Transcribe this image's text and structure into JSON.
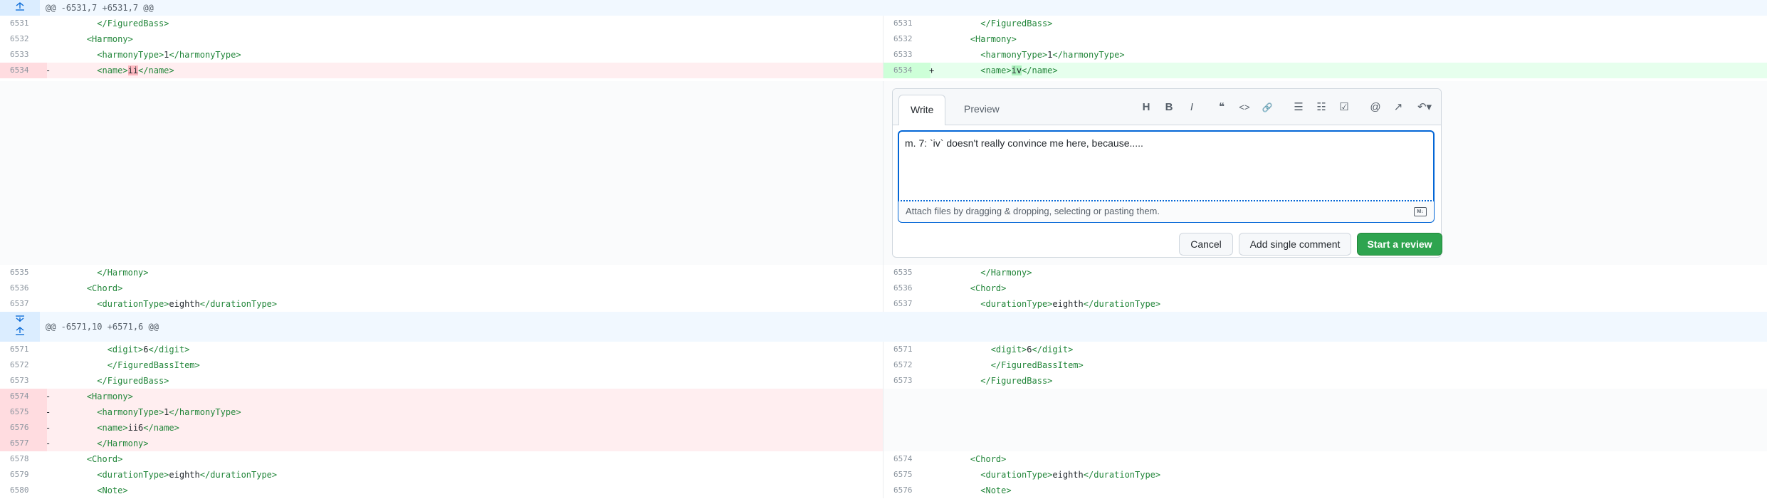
{
  "hunks": [
    {
      "header": "@@ -6531,7 +6531,7 @@"
    },
    {
      "header": "@@ -6571,10 +6571,6 @@"
    }
  ],
  "rows": {
    "r1": {
      "ln": "6531",
      "rn": "6531",
      "lindent": "        ",
      "rindent": "        ",
      "tag1": "</FiguredBass>"
    },
    "r2": {
      "ln": "6532",
      "rn": "6532",
      "lindent": "      ",
      "rindent": "      ",
      "tag1": "<Harmony>"
    },
    "r3": {
      "ln": "6533",
      "rn": "6533",
      "lindent": "        ",
      "rindent": "        ",
      "tag1": "<harmonyType>",
      "val": "1",
      "tag2": "</harmonyType>"
    },
    "r4": {
      "ln": "6534",
      "rn": "6534",
      "lsign": "-",
      "rsign": "+",
      "lindent": "        ",
      "rindent": "        ",
      "tag1": "<name>",
      "lval": "ii",
      "rval": "iv",
      "tag2": "</name>"
    },
    "r5": {
      "ln": "6535",
      "rn": "6535",
      "lindent": "        ",
      "rindent": "        ",
      "tag1": "</Harmony>"
    },
    "r6": {
      "ln": "6536",
      "rn": "6536",
      "lindent": "      ",
      "rindent": "      ",
      "tag1": "<Chord>"
    },
    "r7": {
      "ln": "6537",
      "rn": "6537",
      "lindent": "        ",
      "rindent": "        ",
      "tag1": "<durationType>",
      "val": "eighth",
      "tag2": "</durationType>"
    },
    "r8": {
      "ln": "6571",
      "rn": "6571",
      "lindent": "          ",
      "rindent": "          ",
      "tag1": "<digit>",
      "val": "6",
      "tag2": "</digit>"
    },
    "r9": {
      "ln": "6572",
      "rn": "6572",
      "lindent": "          ",
      "rindent": "          ",
      "tag1": "</FiguredBassItem>"
    },
    "r10": {
      "ln": "6573",
      "rn": "6573",
      "lindent": "        ",
      "rindent": "        ",
      "tag1": "</FiguredBass>"
    },
    "r11": {
      "ln": "6574",
      "lsign": "-",
      "lindent": "      ",
      "tag1": "<Harmony>"
    },
    "r12": {
      "ln": "6575",
      "lsign": "-",
      "lindent": "        ",
      "tag1": "<harmonyType>",
      "val": "1",
      "tag2": "</harmonyType>"
    },
    "r13": {
      "ln": "6576",
      "lsign": "-",
      "lindent": "        ",
      "tag1": "<name>",
      "val": "ii6",
      "tag2": "</name>"
    },
    "r14": {
      "ln": "6577",
      "lsign": "-",
      "lindent": "        ",
      "tag1": "</Harmony>"
    },
    "r15": {
      "ln": "6578",
      "rn": "6574",
      "lindent": "      ",
      "rindent": "      ",
      "tag1": "<Chord>"
    },
    "r16": {
      "ln": "6579",
      "rn": "6575",
      "lindent": "        ",
      "rindent": "        ",
      "tag1": "<durationType>",
      "val": "eighth",
      "tag2": "</durationType>"
    },
    "r17": {
      "ln": "6580",
      "rn": "6576",
      "lindent": "        ",
      "rindent": "        ",
      "tag1": "<Note>"
    }
  },
  "comment": {
    "tab_write": "Write",
    "tab_preview": "Preview",
    "toolbar": {
      "heading": "H",
      "bold": "B",
      "italic": "I",
      "quote": "❝",
      "code": "<>",
      "link": "🔗",
      "bullets": "☰",
      "numbered": "☷",
      "task": "☑",
      "mention": "@",
      "reference": "↗",
      "reply": "↶▾"
    },
    "body": "m. 7: `iv` doesn't really convince me here, because.....",
    "attach_hint": "Attach files by dragging & dropping, selecting or pasting them.",
    "md_badge": "M↓",
    "cancel": "Cancel",
    "add_single": "Add single comment",
    "start_review": "Start a review"
  },
  "colors": {
    "deletion_bg": "#ffeef0",
    "addition_bg": "#e6ffed",
    "tag_green": "#22863a",
    "review_button": "#2ea44f",
    "focus_blue": "#0366d6"
  }
}
